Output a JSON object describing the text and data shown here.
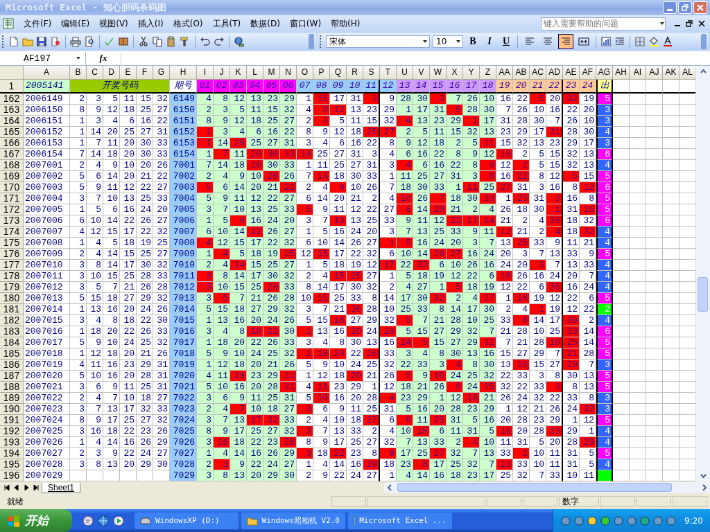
{
  "window": {
    "title": "Microsoft Excel - 知心胆码杀码图"
  },
  "menu": [
    "文件(F)",
    "编辑(E)",
    "视图(V)",
    "插入(I)",
    "格式(O)",
    "工具(T)",
    "数据(D)",
    "窗口(W)",
    "帮助(H)"
  ],
  "help_box": {
    "placeholder": "键入需要帮助的问题"
  },
  "format_toolbar": {
    "font": "宋体",
    "size": "10",
    "styles": [
      "B",
      "I",
      "U"
    ],
    "align_buttons": [
      {
        "kind": "left",
        "selected": false
      },
      {
        "kind": "center",
        "selected": false
      },
      {
        "kind": "right",
        "selected": true
      },
      {
        "kind": "merge",
        "selected": false
      }
    ]
  },
  "name_box": "AF197",
  "function_label": "fx",
  "columns": [
    "A",
    "B",
    "C",
    "D",
    "E",
    "F",
    "G",
    "H",
    "I",
    "J",
    "K",
    "L",
    "M",
    "N",
    "O",
    "P",
    "Q",
    "R",
    "S",
    "T",
    "U",
    "V",
    "W",
    "X",
    "Y",
    "Z",
    "AA",
    "AB",
    "AC",
    "AD",
    "AE",
    "AF",
    "AG",
    "AH",
    "AI",
    "AJ",
    "AK",
    "AL"
  ],
  "header_row": {
    "row": "1",
    "issue": "2005141",
    "draw_label": "开奖号码",
    "period_label": "期号",
    "out_label": "出",
    "numbers": [
      {
        "label": "01",
        "color": "#ff00ff"
      },
      {
        "label": "02",
        "color": "#ff00ff"
      },
      {
        "label": "03",
        "color": "#ff00ff"
      },
      {
        "label": "04",
        "color": "#ff00ff"
      },
      {
        "label": "05",
        "color": "#ff00ff"
      },
      {
        "label": "06",
        "color": "#ff00ff"
      },
      {
        "label": "07",
        "color": "#99ccff"
      },
      {
        "label": "08",
        "color": "#99ccff"
      },
      {
        "label": "09",
        "color": "#99ccff"
      },
      {
        "label": "10",
        "color": "#99ccff"
      },
      {
        "label": "11",
        "color": "#99ccff"
      },
      {
        "label": "12",
        "color": "#99ccff"
      },
      {
        "label": "13",
        "color": "#cc99ff"
      },
      {
        "label": "14",
        "color": "#cc99ff"
      },
      {
        "label": "15",
        "color": "#cc99ff"
      },
      {
        "label": "16",
        "color": "#cc99ff"
      },
      {
        "label": "17",
        "color": "#cc99ff"
      },
      {
        "label": "18",
        "color": "#cc99ff"
      },
      {
        "label": "19",
        "color": "#ffcc99"
      },
      {
        "label": "20",
        "color": "#ffcc99"
      },
      {
        "label": "21",
        "color": "#ffcc99"
      },
      {
        "label": "22",
        "color": "#ffcc99"
      },
      {
        "label": "23",
        "color": "#ffcc99"
      },
      {
        "label": "24",
        "color": "#ffcc99"
      }
    ]
  },
  "rows": [
    {
      "row": "162",
      "issue": "2006149",
      "draw": [
        "2",
        "3",
        "5",
        "11",
        "15",
        "32"
      ],
      "period": "6149",
      "values": [
        "4",
        "8",
        "12",
        "13",
        "23",
        "29",
        "1",
        "15",
        "17",
        "31",
        "3",
        "9",
        "28",
        "30",
        "2",
        "7",
        "26",
        "10",
        "16",
        "22",
        "5",
        "20",
        "32",
        "19"
      ],
      "hits": [
        false,
        false,
        false,
        false,
        false,
        false,
        false,
        true,
        false,
        false,
        true,
        false,
        false,
        false,
        true,
        false,
        false,
        false,
        false,
        false,
        true,
        false,
        true,
        false
      ],
      "out": {
        "value": "5",
        "color": "#ff00ff"
      }
    },
    {
      "row": "163",
      "issue": "2006150",
      "draw": [
        "8",
        "9",
        "12",
        "18",
        "25",
        "27"
      ],
      "period": "6150",
      "values": [
        "2",
        "3",
        "5",
        "11",
        "15",
        "32",
        "4",
        "8",
        "12",
        "13",
        "23",
        "29",
        "1",
        "17",
        "31",
        "9",
        "28",
        "30",
        "7",
        "26",
        "10",
        "16",
        "22",
        "20"
      ],
      "hits": [
        false,
        false,
        false,
        false,
        false,
        false,
        false,
        true,
        true,
        false,
        false,
        false,
        false,
        false,
        false,
        true,
        false,
        false,
        false,
        false,
        false,
        false,
        false,
        false
      ],
      "out": {
        "value": "3",
        "color": "#3366ff"
      }
    },
    {
      "row": "164",
      "issue": "2006151",
      "draw": [
        "1",
        "3",
        "4",
        "6",
        "16",
        "22"
      ],
      "period": "6151",
      "values": [
        "8",
        "9",
        "12",
        "18",
        "25",
        "27",
        "2",
        "3",
        "5",
        "11",
        "15",
        "32",
        "4",
        "13",
        "23",
        "29",
        "1",
        "17",
        "31",
        "28",
        "30",
        "7",
        "26",
        "10"
      ],
      "hits": [
        false,
        false,
        false,
        false,
        false,
        false,
        false,
        true,
        false,
        false,
        false,
        false,
        true,
        false,
        false,
        false,
        true,
        false,
        false,
        false,
        false,
        false,
        false,
        false
      ],
      "out": {
        "value": "3",
        "color": "#3366ff"
      }
    },
    {
      "row": "165",
      "issue": "2006152",
      "draw": [
        "1",
        "14",
        "20",
        "25",
        "27",
        "31"
      ],
      "period": "6152",
      "values": [
        "1",
        "3",
        "4",
        "6",
        "16",
        "22",
        "8",
        "9",
        "12",
        "18",
        "25",
        "27",
        "2",
        "5",
        "11",
        "15",
        "32",
        "13",
        "23",
        "29",
        "17",
        "31",
        "28",
        "30"
      ],
      "hits": [
        true,
        false,
        false,
        false,
        false,
        false,
        false,
        false,
        false,
        false,
        true,
        true,
        false,
        false,
        false,
        false,
        false,
        false,
        false,
        false,
        false,
        true,
        false,
        false
      ],
      "out": {
        "value": "4",
        "color": "#3366ff"
      }
    },
    {
      "row": "166",
      "issue": "2006153",
      "draw": [
        "1",
        "7",
        "11",
        "20",
        "30",
        "33"
      ],
      "period": "6153",
      "values": [
        "1",
        "14",
        "20",
        "25",
        "27",
        "31",
        "3",
        "4",
        "6",
        "16",
        "22",
        "8",
        "9",
        "12",
        "18",
        "2",
        "5",
        "11",
        "15",
        "32",
        "13",
        "23",
        "29",
        "17"
      ],
      "hits": [
        true,
        false,
        true,
        false,
        false,
        false,
        false,
        false,
        false,
        false,
        false,
        false,
        false,
        false,
        false,
        false,
        false,
        true,
        false,
        false,
        false,
        false,
        false,
        false
      ],
      "out": {
        "value": "3",
        "color": "#3366ff"
      }
    },
    {
      "row": "167",
      "issue": "2006154",
      "draw": [
        "7",
        "14",
        "18",
        "20",
        "30",
        "33"
      ],
      "period": "6154",
      "values": [
        "1",
        "7",
        "11",
        "20",
        "30",
        "33",
        "14",
        "25",
        "27",
        "31",
        "3",
        "4",
        "6",
        "16",
        "22",
        "8",
        "9",
        "12",
        "18",
        "2",
        "5",
        "15",
        "32",
        "13"
      ],
      "hits": [
        false,
        true,
        false,
        true,
        true,
        true,
        true,
        false,
        false,
        false,
        false,
        false,
        false,
        false,
        false,
        false,
        false,
        false,
        true,
        false,
        false,
        false,
        false,
        false
      ],
      "out": {
        "value": "6",
        "color": "#ff00ff"
      }
    },
    {
      "row": "168",
      "issue": "2007001",
      "draw": [
        "2",
        "4",
        "9",
        "10",
        "20",
        "26"
      ],
      "period": "7001",
      "values": [
        "7",
        "14",
        "18",
        "20",
        "30",
        "33",
        "1",
        "11",
        "25",
        "27",
        "31",
        "3",
        "4",
        "6",
        "16",
        "22",
        "8",
        "9",
        "12",
        "2",
        "5",
        "15",
        "32",
        "13"
      ],
      "hits": [
        false,
        false,
        false,
        true,
        false,
        false,
        false,
        false,
        false,
        false,
        false,
        false,
        true,
        false,
        false,
        false,
        false,
        true,
        false,
        true,
        false,
        false,
        false,
        false
      ],
      "out": {
        "value": "4",
        "color": "#3366ff"
      }
    },
    {
      "row": "169",
      "issue": "2007002",
      "draw": [
        "5",
        "6",
        "14",
        "20",
        "21",
        "22"
      ],
      "period": "7002",
      "values": [
        "2",
        "4",
        "9",
        "10",
        "20",
        "26",
        "7",
        "14",
        "18",
        "30",
        "33",
        "1",
        "11",
        "25",
        "27",
        "31",
        "3",
        "6",
        "16",
        "22",
        "8",
        "12",
        "5",
        "15"
      ],
      "hits": [
        false,
        false,
        false,
        false,
        true,
        false,
        false,
        true,
        false,
        false,
        false,
        false,
        false,
        false,
        false,
        false,
        false,
        true,
        false,
        true,
        false,
        false,
        true,
        false
      ],
      "out": {
        "value": "5",
        "color": "#ff00ff"
      }
    },
    {
      "row": "170",
      "issue": "2007003",
      "draw": [
        "5",
        "9",
        "11",
        "12",
        "22",
        "27"
      ],
      "period": "7003",
      "values": [
        "5",
        "6",
        "14",
        "20",
        "21",
        "22",
        "2",
        "4",
        "9",
        "10",
        "26",
        "7",
        "18",
        "30",
        "33",
        "1",
        "11",
        "25",
        "27",
        "31",
        "3",
        "16",
        "8",
        "12"
      ],
      "hits": [
        true,
        false,
        false,
        false,
        false,
        true,
        false,
        false,
        true,
        false,
        false,
        false,
        false,
        false,
        false,
        false,
        true,
        false,
        true,
        false,
        false,
        false,
        false,
        true
      ],
      "out": {
        "value": "6",
        "color": "#ff00ff"
      }
    },
    {
      "row": "171",
      "issue": "2007004",
      "draw": [
        "3",
        "7",
        "10",
        "13",
        "25",
        "33"
      ],
      "period": "7004",
      "values": [
        "5",
        "9",
        "11",
        "12",
        "22",
        "27",
        "6",
        "14",
        "20",
        "21",
        "2",
        "4",
        "10",
        "26",
        "7",
        "18",
        "30",
        "33",
        "1",
        "25",
        "31",
        "3",
        "16",
        "8"
      ],
      "hits": [
        false,
        false,
        false,
        false,
        false,
        false,
        false,
        false,
        false,
        false,
        false,
        false,
        true,
        false,
        true,
        false,
        false,
        true,
        false,
        true,
        false,
        true,
        false,
        false
      ],
      "out": {
        "value": "5",
        "color": "#ff00ff"
      }
    },
    {
      "row": "172",
      "issue": "2007005",
      "draw": [
        "1",
        "5",
        "6",
        "16",
        "24",
        "20"
      ],
      "period": "7005",
      "values": [
        "3",
        "7",
        "10",
        "13",
        "25",
        "33",
        "5",
        "9",
        "11",
        "12",
        "22",
        "27",
        "6",
        "14",
        "20",
        "21",
        "2",
        "4",
        "26",
        "18",
        "30",
        "1",
        "31",
        "16"
      ],
      "hits": [
        false,
        false,
        false,
        false,
        false,
        false,
        true,
        false,
        false,
        false,
        false,
        false,
        true,
        false,
        true,
        false,
        false,
        false,
        false,
        false,
        false,
        true,
        false,
        true
      ],
      "out": {
        "value": "5",
        "color": "#ff00ff"
      }
    },
    {
      "row": "173",
      "issue": "2007006",
      "draw": [
        "6",
        "10",
        "14",
        "22",
        "26",
        "27"
      ],
      "period": "7006",
      "values": [
        "1",
        "5",
        "6",
        "16",
        "24",
        "20",
        "3",
        "7",
        "10",
        "13",
        "25",
        "33",
        "9",
        "11",
        "12",
        "22",
        "27",
        "14",
        "21",
        "2",
        "4",
        "26",
        "18",
        "32"
      ],
      "hits": [
        false,
        false,
        true,
        false,
        false,
        false,
        false,
        false,
        true,
        false,
        false,
        false,
        false,
        false,
        false,
        true,
        true,
        true,
        false,
        false,
        false,
        true,
        false,
        false
      ],
      "out": {
        "value": "6",
        "color": "#ff00ff"
      }
    },
    {
      "row": "174",
      "issue": "2007007",
      "draw": [
        "4",
        "12",
        "15",
        "17",
        "22",
        "32"
      ],
      "period": "7007",
      "values": [
        "6",
        "10",
        "14",
        "22",
        "26",
        "27",
        "1",
        "5",
        "16",
        "24",
        "20",
        "3",
        "7",
        "13",
        "25",
        "33",
        "9",
        "11",
        "12",
        "21",
        "2",
        "4",
        "18",
        "32"
      ],
      "hits": [
        false,
        false,
        false,
        true,
        false,
        false,
        false,
        false,
        false,
        false,
        false,
        false,
        false,
        false,
        false,
        false,
        false,
        false,
        true,
        false,
        false,
        true,
        false,
        true
      ],
      "out": {
        "value": "4",
        "color": "#3366ff"
      }
    },
    {
      "row": "175",
      "issue": "2007008",
      "draw": [
        "1",
        "4",
        "5",
        "18",
        "19",
        "25"
      ],
      "period": "7008",
      "values": [
        "4",
        "12",
        "15",
        "17",
        "22",
        "32",
        "6",
        "10",
        "14",
        "26",
        "27",
        "1",
        "5",
        "16",
        "24",
        "20",
        "3",
        "7",
        "13",
        "25",
        "33",
        "9",
        "11",
        "21"
      ],
      "hits": [
        true,
        false,
        false,
        false,
        false,
        false,
        false,
        false,
        false,
        false,
        false,
        true,
        true,
        false,
        false,
        false,
        false,
        false,
        false,
        true,
        false,
        false,
        false,
        false
      ],
      "out": {
        "value": "4",
        "color": "#3366ff"
      }
    },
    {
      "row": "176",
      "issue": "2007009",
      "draw": [
        "2",
        "4",
        "14",
        "15",
        "25",
        "27"
      ],
      "period": "7009",
      "values": [
        "1",
        "4",
        "5",
        "18",
        "19",
        "25",
        "12",
        "15",
        "17",
        "22",
        "32",
        "6",
        "10",
        "14",
        "26",
        "27",
        "16",
        "24",
        "20",
        "3",
        "7",
        "13",
        "33",
        "9"
      ],
      "hits": [
        false,
        true,
        false,
        false,
        false,
        true,
        false,
        true,
        false,
        false,
        false,
        false,
        false,
        false,
        true,
        true,
        false,
        false,
        false,
        false,
        false,
        false,
        false,
        false
      ],
      "out": {
        "value": "5",
        "color": "#ff00ff"
      }
    },
    {
      "row": "177",
      "issue": "2007010",
      "draw": [
        "3",
        "8",
        "14",
        "17",
        "30",
        "32"
      ],
      "period": "7010",
      "values": [
        "2",
        "4",
        "14",
        "15",
        "25",
        "27",
        "1",
        "5",
        "18",
        "19",
        "12",
        "17",
        "22",
        "32",
        "6",
        "10",
        "26",
        "16",
        "24",
        "20",
        "3",
        "7",
        "13",
        "33"
      ],
      "hits": [
        false,
        false,
        true,
        false,
        false,
        false,
        false,
        false,
        false,
        false,
        false,
        true,
        false,
        true,
        false,
        false,
        false,
        false,
        false,
        false,
        true,
        false,
        false,
        false
      ],
      "out": {
        "value": "4",
        "color": "#3366ff"
      }
    },
    {
      "row": "178",
      "issue": "2007011",
      "draw": [
        "3",
        "10",
        "15",
        "25",
        "28",
        "33"
      ],
      "period": "7011",
      "values": [
        "3",
        "8",
        "14",
        "17",
        "30",
        "32",
        "2",
        "4",
        "15",
        "25",
        "27",
        "1",
        "5",
        "18",
        "19",
        "12",
        "22",
        "6",
        "10",
        "26",
        "16",
        "24",
        "20",
        "7"
      ],
      "hits": [
        true,
        false,
        false,
        false,
        false,
        false,
        false,
        false,
        true,
        true,
        false,
        false,
        false,
        false,
        false,
        false,
        false,
        false,
        true,
        false,
        false,
        false,
        false,
        false
      ],
      "out": {
        "value": "4",
        "color": "#3366ff"
      }
    },
    {
      "row": "179",
      "issue": "2007012",
      "draw": [
        "3",
        "5",
        "7",
        "21",
        "26",
        "28"
      ],
      "period": "7012",
      "values": [
        "3",
        "10",
        "15",
        "25",
        "28",
        "33",
        "8",
        "14",
        "17",
        "30",
        "32",
        "2",
        "4",
        "27",
        "1",
        "5",
        "18",
        "19",
        "12",
        "22",
        "6",
        "26",
        "16",
        "24"
      ],
      "hits": [
        true,
        false,
        false,
        false,
        true,
        false,
        false,
        false,
        false,
        false,
        false,
        false,
        false,
        false,
        false,
        true,
        false,
        false,
        false,
        false,
        false,
        true,
        false,
        false
      ],
      "out": {
        "value": "4",
        "color": "#3366ff"
      }
    },
    {
      "row": "180",
      "issue": "2007013",
      "draw": [
        "5",
        "15",
        "18",
        "27",
        "29",
        "32"
      ],
      "period": "7013",
      "values": [
        "3",
        "5",
        "7",
        "21",
        "26",
        "28",
        "10",
        "15",
        "25",
        "33",
        "8",
        "14",
        "17",
        "30",
        "32",
        "2",
        "4",
        "27",
        "1",
        "18",
        "19",
        "12",
        "22",
        "6"
      ],
      "hits": [
        false,
        true,
        false,
        false,
        false,
        false,
        false,
        true,
        false,
        false,
        false,
        false,
        false,
        false,
        true,
        false,
        false,
        true,
        false,
        true,
        false,
        false,
        false,
        false
      ],
      "out": {
        "value": "5",
        "color": "#ff00ff"
      }
    },
    {
      "row": "181",
      "issue": "2007014",
      "draw": [
        "1",
        "13",
        "16",
        "20",
        "24",
        "26"
      ],
      "period": "7014",
      "values": [
        "5",
        "15",
        "18",
        "27",
        "29",
        "32",
        "3",
        "7",
        "21",
        "26",
        "28",
        "10",
        "25",
        "33",
        "8",
        "14",
        "17",
        "30",
        "2",
        "4",
        "1",
        "19",
        "12",
        "22"
      ],
      "hits": [
        false,
        false,
        false,
        false,
        false,
        false,
        false,
        false,
        false,
        true,
        false,
        false,
        false,
        false,
        false,
        false,
        false,
        false,
        false,
        false,
        true,
        false,
        false,
        false
      ],
      "out": {
        "value": "2",
        "color": "#00ff00"
      }
    },
    {
      "row": "182",
      "issue": "2007015",
      "draw": [
        "3",
        "4",
        "8",
        "18",
        "22",
        "30"
      ],
      "period": "7015",
      "values": [
        "1",
        "13",
        "16",
        "20",
        "24",
        "26",
        "5",
        "15",
        "18",
        "27",
        "29",
        "32",
        "3",
        "7",
        "21",
        "28",
        "10",
        "25",
        "33",
        "8",
        "14",
        "17",
        "30",
        "2"
      ],
      "hits": [
        false,
        false,
        false,
        false,
        false,
        false,
        false,
        false,
        true,
        false,
        false,
        false,
        true,
        false,
        false,
        false,
        false,
        false,
        false,
        true,
        false,
        false,
        true,
        false
      ],
      "out": {
        "value": "4",
        "color": "#3366ff"
      }
    },
    {
      "row": "183",
      "issue": "2007016",
      "draw": [
        "1",
        "18",
        "20",
        "22",
        "26",
        "33"
      ],
      "period": "7016",
      "values": [
        "3",
        "4",
        "8",
        "18",
        "22",
        "30",
        "1",
        "13",
        "16",
        "20",
        "24",
        "26",
        "5",
        "15",
        "27",
        "29",
        "32",
        "7",
        "21",
        "28",
        "10",
        "25",
        "33",
        "14"
      ],
      "hits": [
        false,
        false,
        false,
        true,
        true,
        false,
        true,
        false,
        false,
        true,
        false,
        true,
        false,
        false,
        false,
        false,
        false,
        false,
        false,
        false,
        false,
        false,
        true,
        false
      ],
      "out": {
        "value": "6",
        "color": "#ff00ff"
      }
    },
    {
      "row": "184",
      "issue": "2007017",
      "draw": [
        "5",
        "9",
        "10",
        "24",
        "25",
        "32"
      ],
      "period": "7017",
      "values": [
        "1",
        "18",
        "20",
        "22",
        "26",
        "33",
        "3",
        "4",
        "8",
        "30",
        "13",
        "16",
        "24",
        "5",
        "15",
        "27",
        "29",
        "32",
        "7",
        "21",
        "28",
        "10",
        "25",
        "14"
      ],
      "hits": [
        false,
        false,
        false,
        false,
        false,
        false,
        false,
        false,
        false,
        false,
        false,
        false,
        true,
        true,
        false,
        false,
        false,
        true,
        false,
        false,
        false,
        true,
        true,
        false
      ],
      "out": {
        "value": "5",
        "color": "#ff00ff"
      }
    },
    {
      "row": "185",
      "issue": "2007018",
      "draw": [
        "1",
        "12",
        "18",
        "20",
        "21",
        "26"
      ],
      "period": "7018",
      "values": [
        "5",
        "9",
        "10",
        "24",
        "25",
        "32",
        "1",
        "18",
        "20",
        "22",
        "26",
        "33",
        "3",
        "4",
        "8",
        "30",
        "13",
        "16",
        "15",
        "27",
        "29",
        "7",
        "21",
        "28"
      ],
      "hits": [
        false,
        false,
        false,
        false,
        false,
        false,
        true,
        true,
        true,
        false,
        true,
        false,
        false,
        false,
        false,
        false,
        false,
        false,
        false,
        false,
        false,
        false,
        true,
        false
      ],
      "out": {
        "value": "5",
        "color": "#ff00ff"
      }
    },
    {
      "row": "186",
      "issue": "2007019",
      "draw": [
        "4",
        "11",
        "16",
        "23",
        "29",
        "31"
      ],
      "period": "7019",
      "values": [
        "1",
        "12",
        "18",
        "20",
        "21",
        "26",
        "5",
        "9",
        "10",
        "24",
        "25",
        "32",
        "22",
        "33",
        "3",
        "4",
        "8",
        "30",
        "13",
        "16",
        "15",
        "27",
        "29",
        "7"
      ],
      "hits": [
        false,
        false,
        false,
        false,
        false,
        false,
        false,
        false,
        false,
        false,
        false,
        false,
        false,
        false,
        false,
        true,
        false,
        false,
        false,
        true,
        false,
        false,
        true,
        false
      ],
      "out": {
        "value": "3",
        "color": "#3366ff"
      }
    },
    {
      "row": "187",
      "issue": "2007020",
      "draw": [
        "5",
        "10",
        "16",
        "20",
        "28",
        "31"
      ],
      "period": "7020",
      "values": [
        "4",
        "11",
        "16",
        "23",
        "29",
        "31",
        "1",
        "12",
        "18",
        "20",
        "21",
        "26",
        "5",
        "9",
        "10",
        "24",
        "25",
        "32",
        "22",
        "33",
        "3",
        "8",
        "30",
        "13"
      ],
      "hits": [
        false,
        false,
        true,
        false,
        false,
        true,
        false,
        false,
        false,
        true,
        false,
        false,
        true,
        false,
        true,
        false,
        false,
        false,
        false,
        false,
        false,
        false,
        false,
        false
      ],
      "out": {
        "value": "5",
        "color": "#ff00ff"
      }
    },
    {
      "row": "188",
      "issue": "2007021",
      "draw": [
        "3",
        "6",
        "9",
        "11",
        "25",
        "31"
      ],
      "period": "7021",
      "values": [
        "5",
        "10",
        "16",
        "20",
        "28",
        "31",
        "4",
        "11",
        "23",
        "29",
        "1",
        "12",
        "18",
        "21",
        "26",
        "9",
        "24",
        "25",
        "32",
        "22",
        "33",
        "3",
        "8",
        "13"
      ],
      "hits": [
        false,
        false,
        false,
        false,
        false,
        true,
        false,
        true,
        false,
        false,
        false,
        false,
        false,
        false,
        false,
        true,
        false,
        true,
        false,
        false,
        false,
        true,
        false,
        false
      ],
      "out": {
        "value": "5",
        "color": "#ff00ff"
      }
    },
    {
      "row": "189",
      "issue": "2007022",
      "draw": [
        "2",
        "4",
        "7",
        "10",
        "18",
        "27"
      ],
      "period": "7022",
      "values": [
        "3",
        "6",
        "9",
        "11",
        "25",
        "31",
        "5",
        "10",
        "16",
        "20",
        "28",
        "4",
        "23",
        "29",
        "1",
        "12",
        "18",
        "21",
        "26",
        "24",
        "32",
        "22",
        "33",
        "8"
      ],
      "hits": [
        false,
        false,
        false,
        false,
        false,
        false,
        false,
        true,
        false,
        false,
        false,
        true,
        false,
        false,
        false,
        false,
        true,
        false,
        false,
        false,
        false,
        false,
        false,
        false
      ],
      "out": {
        "value": "3",
        "color": "#3366ff"
      }
    },
    {
      "row": "190",
      "issue": "2007023",
      "draw": [
        "3",
        "7",
        "13",
        "17",
        "32",
        "33"
      ],
      "period": "7023",
      "values": [
        "2",
        "4",
        "7",
        "10",
        "18",
        "27",
        "3",
        "6",
        "9",
        "11",
        "25",
        "31",
        "5",
        "16",
        "20",
        "28",
        "23",
        "29",
        "1",
        "12",
        "21",
        "26",
        "24",
        "32"
      ],
      "hits": [
        false,
        false,
        true,
        false,
        false,
        false,
        true,
        false,
        false,
        false,
        false,
        false,
        false,
        false,
        false,
        false,
        false,
        false,
        false,
        false,
        false,
        false,
        false,
        true
      ],
      "out": {
        "value": "3",
        "color": "#3366ff"
      }
    },
    {
      "row": "191",
      "issue": "2007024",
      "draw": [
        "8",
        "9",
        "17",
        "25",
        "27",
        "32"
      ],
      "period": "7024",
      "values": [
        "3",
        "7",
        "13",
        "17",
        "32",
        "33",
        "2",
        "4",
        "10",
        "18",
        "27",
        "6",
        "9",
        "11",
        "25",
        "31",
        "5",
        "16",
        "20",
        "28",
        "23",
        "29",
        "1",
        "12"
      ],
      "hits": [
        false,
        false,
        false,
        true,
        true,
        false,
        false,
        false,
        false,
        false,
        true,
        false,
        true,
        false,
        true,
        false,
        false,
        false,
        false,
        false,
        false,
        false,
        false,
        false
      ],
      "out": {
        "value": "5",
        "color": "#ff00ff"
      }
    },
    {
      "row": "192",
      "issue": "2007025",
      "draw": [
        "3",
        "16",
        "18",
        "22",
        "23",
        "26"
      ],
      "period": "7025",
      "values": [
        "8",
        "9",
        "17",
        "25",
        "27",
        "32",
        "3",
        "7",
        "13",
        "33",
        "2",
        "4",
        "10",
        "18",
        "6",
        "11",
        "31",
        "5",
        "16",
        "20",
        "28",
        "23",
        "29",
        "1"
      ],
      "hits": [
        false,
        false,
        false,
        false,
        false,
        false,
        true,
        false,
        false,
        false,
        false,
        false,
        false,
        true,
        false,
        false,
        false,
        false,
        true,
        false,
        false,
        true,
        false,
        false
      ],
      "out": {
        "value": "4",
        "color": "#3366ff"
      }
    },
    {
      "row": "193",
      "issue": "2007026",
      "draw": [
        "1",
        "4",
        "14",
        "16",
        "26",
        "29"
      ],
      "period": "7026",
      "values": [
        "3",
        "16",
        "18",
        "22",
        "23",
        "26",
        "8",
        "9",
        "17",
        "25",
        "27",
        "32",
        "7",
        "13",
        "33",
        "2",
        "4",
        "10",
        "11",
        "31",
        "5",
        "20",
        "28",
        "29"
      ],
      "hits": [
        false,
        true,
        false,
        false,
        false,
        true,
        false,
        false,
        false,
        false,
        false,
        false,
        false,
        false,
        false,
        false,
        true,
        false,
        false,
        false,
        false,
        false,
        false,
        true
      ],
      "out": {
        "value": "4",
        "color": "#3366ff"
      }
    },
    {
      "row": "194",
      "issue": "2007027",
      "draw": [
        "2",
        "3",
        "9",
        "22",
        "24",
        "27"
      ],
      "period": "7027",
      "values": [
        "1",
        "4",
        "14",
        "16",
        "26",
        "29",
        "3",
        "18",
        "22",
        "23",
        "8",
        "9",
        "17",
        "25",
        "27",
        "32",
        "7",
        "13",
        "33",
        "2",
        "10",
        "11",
        "31",
        "5"
      ],
      "hits": [
        false,
        false,
        false,
        false,
        false,
        false,
        true,
        false,
        true,
        false,
        false,
        true,
        false,
        false,
        true,
        false,
        false,
        false,
        false,
        true,
        false,
        false,
        false,
        false
      ],
      "out": {
        "value": "5",
        "color": "#ff00ff"
      }
    },
    {
      "row": "195",
      "issue": "2007028",
      "draw": [
        "3",
        "8",
        "13",
        "20",
        "29",
        "30"
      ],
      "period": "7028",
      "values": [
        "2",
        "3",
        "9",
        "22",
        "24",
        "27",
        "1",
        "4",
        "14",
        "16",
        "29",
        "18",
        "23",
        "8",
        "17",
        "25",
        "32",
        "7",
        "13",
        "33",
        "10",
        "11",
        "31",
        "5"
      ],
      "hits": [
        false,
        true,
        false,
        false,
        false,
        false,
        false,
        false,
        false,
        false,
        true,
        false,
        false,
        true,
        false,
        false,
        false,
        false,
        true,
        false,
        false,
        false,
        false,
        false
      ],
      "out": {
        "value": "4",
        "color": "#3366ff"
      }
    },
    {
      "row": "196",
      "issue": "2007029",
      "period": "7029",
      "values": [
        "3",
        "8",
        "13",
        "20",
        "29",
        "30",
        "2",
        "9",
        "22",
        "24",
        "27",
        "1",
        "4",
        "14",
        "16",
        "18",
        "23",
        "17",
        "25",
        "32",
        "7",
        "33",
        "10",
        "11"
      ],
      "hits": [
        false,
        false,
        false,
        false,
        false,
        false,
        false,
        false,
        false,
        false,
        false,
        false,
        false,
        false,
        false,
        false,
        false,
        false,
        false,
        false,
        false,
        false,
        false,
        false
      ],
      "out": {
        "color": "#00ff00"
      }
    }
  ],
  "sheet_tabs": [
    {
      "label": "Sheet1",
      "selected": true
    }
  ],
  "status_bar": {
    "state": "就绪",
    "mode": "数字"
  },
  "taskbar": {
    "start": "开始",
    "tasks": [
      {
        "label": "WindowsXP (D:)",
        "kind": "drive"
      },
      {
        "label": "Windows照相机 V2.0",
        "kind": "folder"
      },
      {
        "label": "Microsoft Excel ...",
        "kind": "excel"
      }
    ],
    "clock": "9:20"
  }
}
